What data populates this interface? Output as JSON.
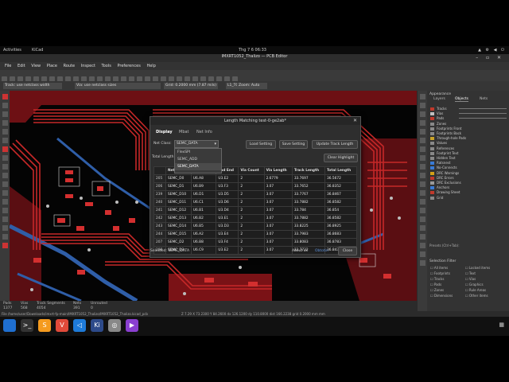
{
  "topbar": {
    "activities": "Activities",
    "app": "KiCad",
    "clock": "Thg 7 6  06:33"
  },
  "window": {
    "title": "IMXRT1052_Thalizo — PCB Editor"
  },
  "menu": [
    "File",
    "Edit",
    "View",
    "Place",
    "Route",
    "Inspect",
    "Tools",
    "Preferences",
    "Help"
  ],
  "toolbar2": {
    "track": "Track: use netclass width",
    "via": "Via: use netclass sizes",
    "grid": "Grid: 0.2000 mm (7.87 mils)",
    "layer": "L1_TOP (PgUp)",
    "zoom": "Zoom: Auto"
  },
  "appearance": {
    "title": "Appearance",
    "tabs": [
      "Layers",
      "Objects",
      "Nets"
    ],
    "objects": [
      {
        "label": "Tracks",
        "color": "#c0392b"
      },
      {
        "label": "Vias",
        "color": "#c0c0c0"
      },
      {
        "label": "Pads",
        "color": "#c0392b"
      },
      {
        "label": "Zones",
        "color": "#888888"
      },
      {
        "label": "Footprints Front",
        "color": "#888888"
      },
      {
        "label": "Footprints Back",
        "color": "#888888"
      },
      {
        "label": "Through-hole Pads",
        "color": "#c9a227"
      },
      {
        "label": "Values",
        "color": "#888888"
      },
      {
        "label": "References",
        "color": "#888888"
      },
      {
        "label": "Footprint Text",
        "color": "#888888"
      },
      {
        "label": "Hidden Text",
        "color": "#888888"
      },
      {
        "label": "Ratsnest",
        "color": "#3a7bd5"
      },
      {
        "label": "No-Connects",
        "color": "#3a7bd5"
      },
      {
        "label": "DRC Warnings",
        "color": "#d4a017"
      },
      {
        "label": "DRC Errors",
        "color": "#c0392b"
      },
      {
        "label": "DRC Exclusions",
        "color": "#999999"
      },
      {
        "label": "Anchors",
        "color": "#3a7bd5"
      },
      {
        "label": "Drawing Sheet",
        "color": "#c0392b"
      },
      {
        "label": "Grid",
        "color": "#888888"
      }
    ],
    "presets_label": "Presets (Ctrl+Tab):",
    "selection_filter_title": "Selection Filter",
    "selection_filter": [
      "All items",
      "Locked items",
      "Footprints",
      "Text",
      "Tracks",
      "Vias",
      "Pads",
      "Graphics",
      "Zones",
      "Rule Areas",
      "Dimensions",
      "Other items"
    ]
  },
  "status": {
    "cols": [
      {
        "label": "Pads",
        "value": "1377"
      },
      {
        "label": "Vias",
        "value": "568"
      },
      {
        "label": "Track Segments",
        "value": "4054"
      },
      {
        "label": "Nets",
        "value": "391"
      },
      {
        "label": "Unrouted",
        "value": "0"
      }
    ],
    "file": "File /home/user/Downloads/imxrt-fp-main/IMXRT1052_Thalizo/IMXRT1052_Thalizo.kicad_pcb",
    "coords": "Z 7.29     X 73.2300 Y 84.2600     dx 126.1200  dy 110.8000  dist 166.2238     grid 0.2000 mm     mm"
  },
  "dialog": {
    "title": "Length Matching test-0-ge2ab*",
    "tabs": [
      "Display",
      "Mbat",
      "Net Info"
    ],
    "net_class_label": "Net Class:",
    "net_class_value": "SEMC_DATA",
    "total_length_label": "Total Length:",
    "total_length_suffix": "th",
    "buttons": {
      "load": "Load Setting",
      "save": "Save Setting",
      "update": "Update Track Length",
      "clear": "Clear Highlight",
      "close": "Close"
    },
    "dropdown_options": [
      "FlexSPI",
      "SEMC_ADD",
      "SEMC_DATA"
    ],
    "dropdown_selected": 2,
    "columns": [
      "",
      "Net",
      "Pad Start",
      "Pad End",
      "Via Count",
      "Via Length",
      "Track Length",
      "Total Length"
    ],
    "rows": [
      [
        "205",
        "SEMC_D0",
        "U6.A8",
        "U3.E2",
        "2",
        "2.6779",
        "33.7697",
        "36.5672"
      ],
      [
        "206",
        "SEMC_D1",
        "U6.B9",
        "U3.F3",
        "2",
        "3.07",
        "33.7652",
        "36.8352"
      ],
      [
        "239",
        "SEMC_D10",
        "U6.D1",
        "U3.D5",
        "2",
        "3.07",
        "33.7767",
        "36.8467"
      ],
      [
        "240",
        "SEMC_D11",
        "U6.C1",
        "U3.D6",
        "2",
        "3.07",
        "33.7882",
        "36.8582"
      ],
      [
        "241",
        "SEMC_D12",
        "U6.B1",
        "U3.D4",
        "2",
        "3.07",
        "33.784",
        "36.854"
      ],
      [
        "242",
        "SEMC_D13",
        "U6.B2",
        "U3.E1",
        "2",
        "3.07",
        "33.7882",
        "36.8582"
      ],
      [
        "243",
        "SEMC_D14",
        "U6.B5",
        "U3.D3",
        "2",
        "3.07",
        "33.8225",
        "36.8925"
      ],
      [
        "244",
        "SEMC_D15",
        "U6.A2",
        "U3.E4",
        "2",
        "3.07",
        "33.7983",
        "36.8683"
      ],
      [
        "207",
        "SEMC_D2",
        "U6.B8",
        "U3.F4",
        "2",
        "3.07",
        "33.8083",
        "36.8783"
      ],
      [
        "208",
        "SEMC_D3",
        "U6.C9",
        "U3.E2",
        "2",
        "3.07",
        "33.7732",
        "36.8432"
      ]
    ],
    "footer_selected": "Selected: SEMC_DATA",
    "about": "About us",
    "link": "Obtotin"
  },
  "taskbar": [
    {
      "name": "windows-icon",
      "glyph": "",
      "color": "#1f6fd1"
    },
    {
      "name": "terminal-icon",
      "glyph": ">_",
      "color": "#333333"
    },
    {
      "name": "sublime-icon",
      "glyph": "S",
      "color": "#f59b1f"
    },
    {
      "name": "vivaldi-icon",
      "glyph": "V",
      "color": "#e04a3a"
    },
    {
      "name": "vscode-icon",
      "glyph": "◁",
      "color": "#1e7ad8"
    },
    {
      "name": "kicad-icon",
      "glyph": "Ki",
      "color": "#2d4a8a"
    },
    {
      "name": "chrome-icon",
      "glyph": "◎",
      "color": "#888888"
    },
    {
      "name": "media-icon",
      "glyph": "▶",
      "color": "#8a3fd0"
    }
  ]
}
